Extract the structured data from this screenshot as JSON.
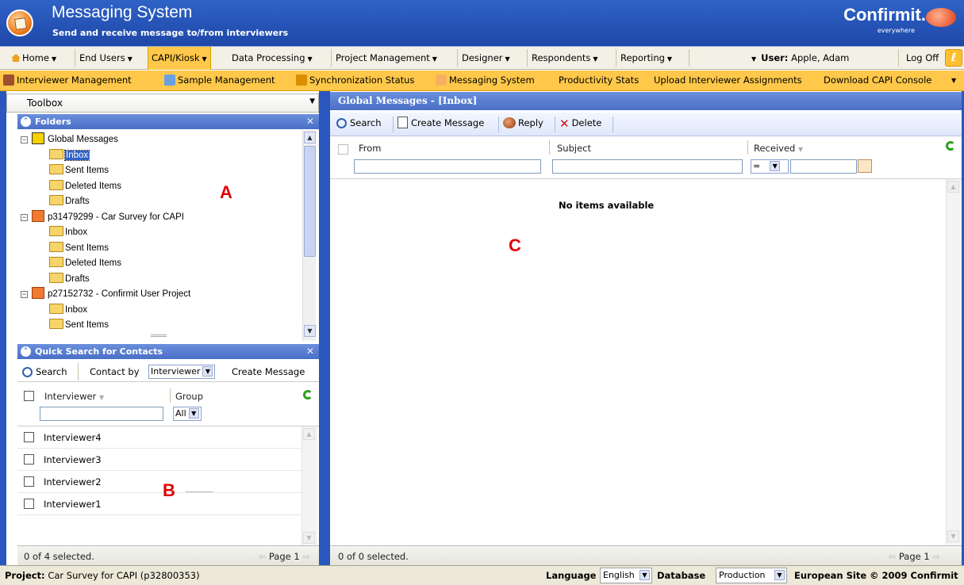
{
  "header": {
    "title": "Messaging System",
    "subtitle": "Send and receive message to/from interviewers",
    "brand": "Confirmit.",
    "brand_tagline": "everywhere"
  },
  "menu": {
    "items": [
      {
        "label": "Home"
      },
      {
        "label": "End Users"
      },
      {
        "label": "CAPI/Kiosk",
        "active": true
      },
      {
        "label": "Data Processing"
      },
      {
        "label": "Project Management"
      },
      {
        "label": "Designer"
      },
      {
        "label": "Respondents"
      },
      {
        "label": "Reporting"
      }
    ],
    "user_label": "User:",
    "user_name": "Apple, Adam",
    "logoff": "Log Off"
  },
  "submenu": {
    "items": [
      {
        "label": "Interviewer Management",
        "icon": "interviewer-icon"
      },
      {
        "label": "Sample Management",
        "icon": "sample-icon"
      },
      {
        "label": "Synchronization Status",
        "icon": "sync-icon"
      },
      {
        "label": "Messaging System",
        "icon": "envelope-icon"
      },
      {
        "label": "Productivity Stats"
      },
      {
        "label": "Upload Interviewer Assignments"
      },
      {
        "label": "Download CAPI Console"
      }
    ]
  },
  "toolbox": {
    "label": "Toolbox"
  },
  "folders": {
    "title": "Folders",
    "tree": [
      {
        "label": "Global Messages",
        "type": "root-global"
      },
      {
        "label": "Inbox",
        "type": "folder",
        "selected": true
      },
      {
        "label": "Sent Items",
        "type": "folder"
      },
      {
        "label": "Deleted Items",
        "type": "folder"
      },
      {
        "label": "Drafts",
        "type": "folder"
      },
      {
        "label": "p31479299 - Car Survey for CAPI",
        "type": "root-project"
      },
      {
        "label": "Inbox",
        "type": "folder"
      },
      {
        "label": "Sent Items",
        "type": "folder"
      },
      {
        "label": "Deleted Items",
        "type": "folder"
      },
      {
        "label": "Drafts",
        "type": "folder"
      },
      {
        "label": "p27152732 - Confirmit User Project",
        "type": "root-project"
      },
      {
        "label": "Inbox",
        "type": "folder"
      },
      {
        "label": "Sent Items",
        "type": "folder"
      }
    ]
  },
  "annotations": {
    "a": "A",
    "b": "B",
    "c": "C"
  },
  "quick_search": {
    "title": "Quick Search for Contacts",
    "search_label": "Search",
    "contact_by_label": "Contact by",
    "contact_by_value": "Interviewer",
    "create_message_label": "Create Message",
    "col_interviewer": "Interviewer",
    "col_group": "Group",
    "group_filter_value": "All",
    "rows": [
      "Interviewer4",
      "Interviewer3",
      "Interviewer2",
      "Interviewer1"
    ],
    "selected_text": "0 of 4 selected.",
    "page_text": "Page 1"
  },
  "main": {
    "title": "Global Messages  -  [Inbox]",
    "toolbar": {
      "search": "Search",
      "create": "Create Message",
      "reply": "Reply",
      "delete": "Delete"
    },
    "col_from": "From",
    "col_subject": "Subject",
    "col_received": "Received",
    "received_op": "=",
    "empty_text": "No items available",
    "selected_text": "0 of 0 selected.",
    "page_text": "Page 1"
  },
  "status": {
    "project_label": "Project:",
    "project_value": "Car Survey for CAPI (p32800353)",
    "language_label": "Language",
    "language_value": "English",
    "database_label": "Database",
    "database_value": "Production",
    "site": "European Site",
    "copyright": "© 2009 Confirmit"
  },
  "colors": {
    "header_blue": "#2a57be",
    "menu_highlight": "#ffc84a",
    "annotation_red": "#e00000"
  }
}
